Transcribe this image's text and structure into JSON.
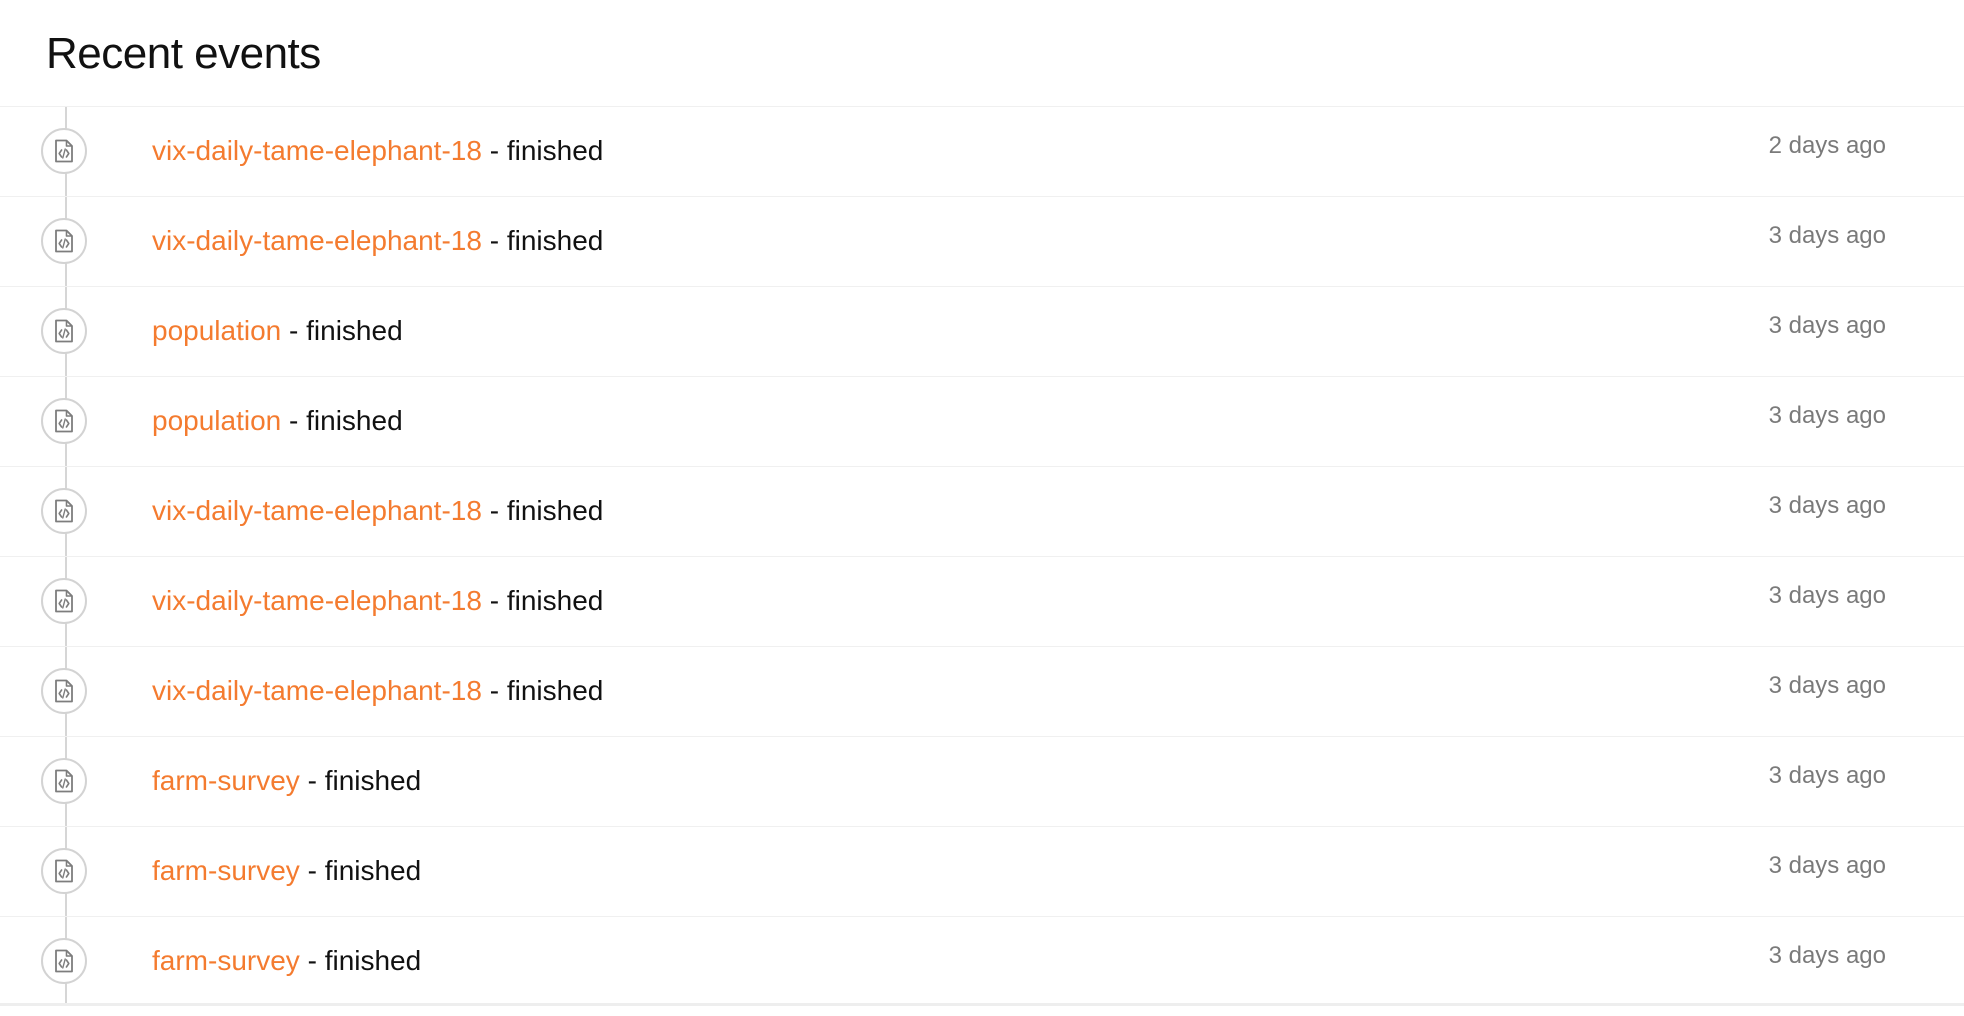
{
  "header": {
    "title": "Recent events"
  },
  "colors": {
    "link": "#f47b2f",
    "text": "#111111",
    "muted": "#7a7a7a",
    "timeline": "#d6d6d6"
  },
  "events": [
    {
      "name": "vix-daily-tame-elephant-18",
      "separator": " - ",
      "status": "finished",
      "time": "2 days ago",
      "icon": "code-file-icon"
    },
    {
      "name": "vix-daily-tame-elephant-18",
      "separator": " - ",
      "status": "finished",
      "time": "3 days ago",
      "icon": "code-file-icon"
    },
    {
      "name": "population",
      "separator": " - ",
      "status": "finished",
      "time": "3 days ago",
      "icon": "code-file-icon"
    },
    {
      "name": "population",
      "separator": " - ",
      "status": "finished",
      "time": "3 days ago",
      "icon": "code-file-icon"
    },
    {
      "name": "vix-daily-tame-elephant-18",
      "separator": " - ",
      "status": "finished",
      "time": "3 days ago",
      "icon": "code-file-icon"
    },
    {
      "name": "vix-daily-tame-elephant-18",
      "separator": " - ",
      "status": "finished",
      "time": "3 days ago",
      "icon": "code-file-icon"
    },
    {
      "name": "vix-daily-tame-elephant-18",
      "separator": " - ",
      "status": "finished",
      "time": "3 days ago",
      "icon": "code-file-icon"
    },
    {
      "name": "farm-survey",
      "separator": " - ",
      "status": "finished",
      "time": "3 days ago",
      "icon": "code-file-icon"
    },
    {
      "name": "farm-survey",
      "separator": " - ",
      "status": "finished",
      "time": "3 days ago",
      "icon": "code-file-icon"
    },
    {
      "name": "farm-survey",
      "separator": " - ",
      "status": "finished",
      "time": "3 days ago",
      "icon": "code-file-icon"
    }
  ]
}
